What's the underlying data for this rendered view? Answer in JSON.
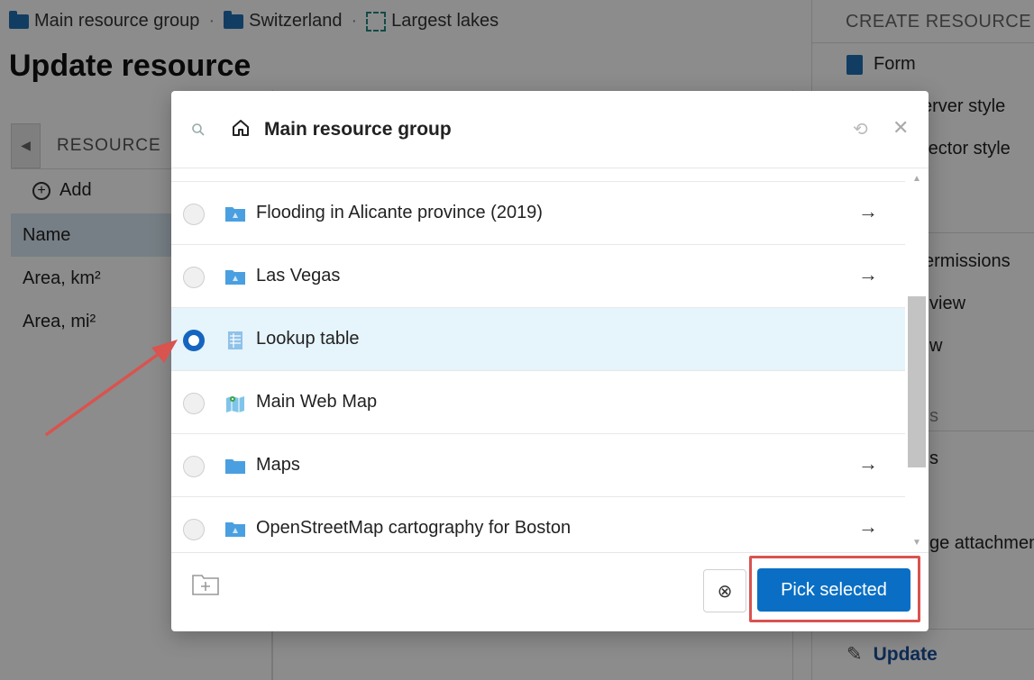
{
  "breadcrumb": {
    "items": [
      {
        "label": "Main resource group",
        "icon": "folder-icon"
      },
      {
        "label": "Switzerland",
        "icon": "folder-icon"
      },
      {
        "label": "Largest lakes",
        "icon": "table-icon"
      }
    ],
    "separator": "·"
  },
  "page": {
    "title": "Update resource"
  },
  "left_panel": {
    "tab_label": "RESOURCE",
    "add_label": "Add",
    "fields": [
      "Name",
      "Area, km²",
      "Area, mi²"
    ]
  },
  "right_panel": {
    "heading": "CREATE RESOURCE",
    "items": [
      "Form",
      "erver style",
      "rector style",
      "ermissions",
      "view",
      "w",
      "s",
      "s",
      "ge attachmen"
    ],
    "update_label": "Update"
  },
  "modal": {
    "title": "Main resource group",
    "items": [
      {
        "label": "Flooding in Alicante province (2019)",
        "icon": "resource-group-icon",
        "has_arrow": true,
        "selected": false
      },
      {
        "label": "Las Vegas",
        "icon": "resource-group-icon",
        "has_arrow": true,
        "selected": false
      },
      {
        "label": "Lookup table",
        "icon": "lookup-table-icon",
        "has_arrow": false,
        "selected": true
      },
      {
        "label": "Main Web Map",
        "icon": "web-map-icon",
        "has_arrow": false,
        "selected": false
      },
      {
        "label": "Maps",
        "icon": "folder-icon",
        "has_arrow": true,
        "selected": false
      },
      {
        "label": "OpenStreetMap cartography for Boston",
        "icon": "resource-group-icon",
        "has_arrow": true,
        "selected": false
      }
    ],
    "pick_label": "Pick selected"
  },
  "colors": {
    "accent": "#0a6fc4",
    "selected_row": "#e6f4fb",
    "highlight": "#d9534f"
  }
}
